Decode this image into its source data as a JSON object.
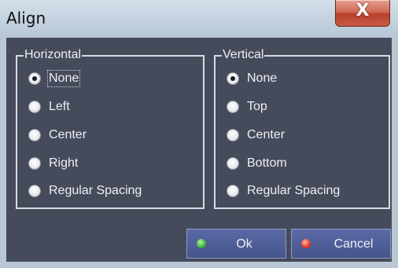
{
  "window": {
    "title": "Align",
    "close_glyph": "X"
  },
  "horizontal": {
    "legend": "Horizontal",
    "options": [
      "None",
      "Left",
      "Center",
      "Right",
      "Regular Spacing"
    ],
    "selected_index": 0
  },
  "vertical": {
    "legend": "Vertical",
    "options": [
      "None",
      "Top",
      "Center",
      "Bottom",
      "Regular Spacing"
    ],
    "selected_index": 0
  },
  "buttons": {
    "ok_label": "Ok",
    "cancel_label": "Cancel",
    "ok_indicator_color": "#3db33a",
    "cancel_indicator_color": "#e33a25"
  },
  "colors": {
    "dialog_background": "#454b5b",
    "button_background": "#4f5e98",
    "close_button": "#c85a45"
  }
}
